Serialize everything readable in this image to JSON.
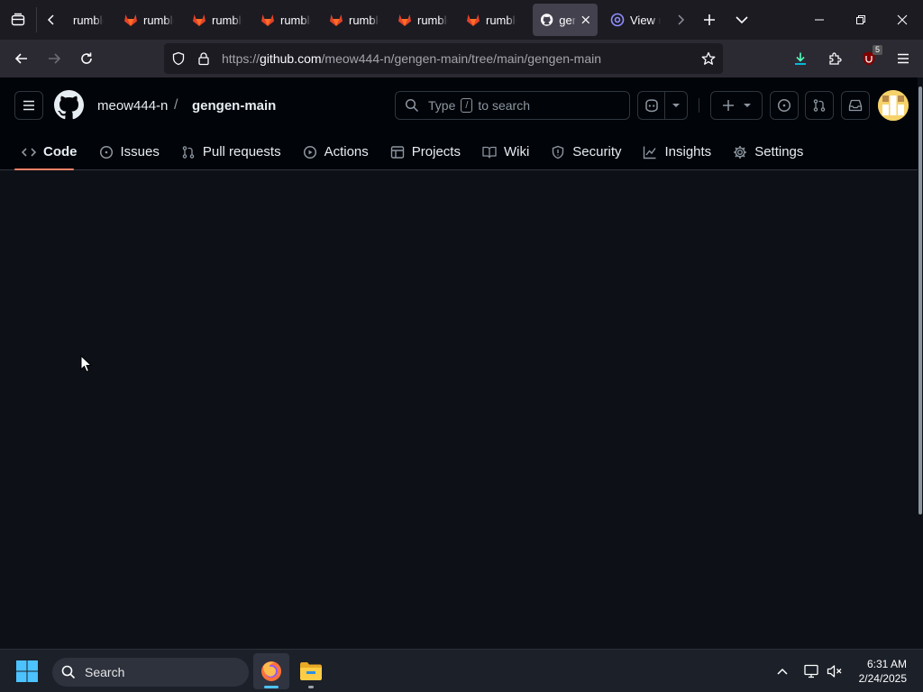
{
  "browser": {
    "tabs": [
      {
        "label": "rumble",
        "icon": "gitlab-icon",
        "active": false
      },
      {
        "label": "rumble",
        "icon": "gitlab-icon",
        "active": false
      },
      {
        "label": "rumble",
        "icon": "gitlab-icon",
        "active": false
      },
      {
        "label": "rumble",
        "icon": "gitlab-icon",
        "active": false
      },
      {
        "label": "rumble",
        "icon": "gitlab-icon",
        "active": false
      },
      {
        "label": "rumble",
        "icon": "gitlab-icon",
        "active": false
      },
      {
        "label": "rumble",
        "icon": "gitlab-icon",
        "active": false
      },
      {
        "label": "gen",
        "icon": "github-icon",
        "active": true
      },
      {
        "label": "View r",
        "icon": "at-sign-icon",
        "active": false
      }
    ],
    "url_prefix": "https://",
    "url_domain": "github.com",
    "url_path": "/meow444-n/gengen-main/tree/main/gengen-main",
    "extension_badge": "5"
  },
  "github": {
    "owner": "meow444-n",
    "separator": "/",
    "repo": "gengen-main",
    "search": {
      "before": "Type",
      "key": "/",
      "after": "to search"
    },
    "tabs": [
      {
        "label": "Code",
        "icon": "code-icon",
        "selected": true
      },
      {
        "label": "Issues",
        "icon": "issue-icon",
        "selected": false
      },
      {
        "label": "Pull requests",
        "icon": "pull-request-icon",
        "selected": false
      },
      {
        "label": "Actions",
        "icon": "play-icon",
        "selected": false
      },
      {
        "label": "Projects",
        "icon": "table-icon",
        "selected": false
      },
      {
        "label": "Wiki",
        "icon": "book-icon",
        "selected": false
      },
      {
        "label": "Security",
        "icon": "shield-icon",
        "selected": false
      },
      {
        "label": "Insights",
        "icon": "graph-icon",
        "selected": false
      },
      {
        "label": "Settings",
        "icon": "gear-icon",
        "selected": false
      }
    ]
  },
  "taskbar": {
    "search_label": "Search",
    "time": "6:31 AM",
    "date": "2/24/2025"
  },
  "colors": {
    "page_bg": "#0d1117",
    "header_bg": "#010409",
    "accent_underline": "#f78166",
    "firefox_tab_bg": "#1c1b22",
    "gitlab_orange": "#e24329"
  }
}
